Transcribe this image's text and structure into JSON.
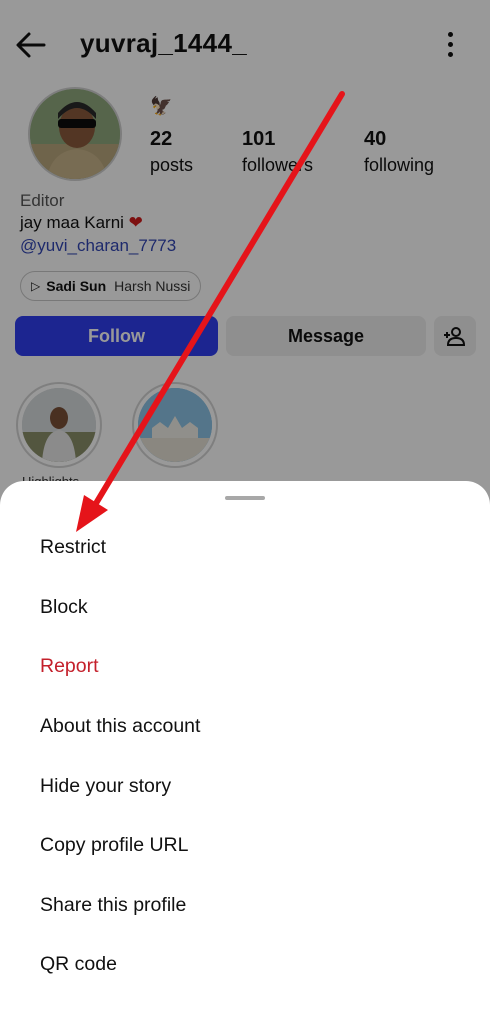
{
  "header": {
    "username": "yuvraj_1444_",
    "back_icon": "arrow-left-icon",
    "options_icon": "more-vertical-icon"
  },
  "profile": {
    "stats": [
      {
        "value": "22",
        "label": "posts"
      },
      {
        "value": "101",
        "label": "followers"
      },
      {
        "value": "40",
        "label": "following"
      }
    ],
    "bio": {
      "category": "Editor",
      "line": "jay maa Karni",
      "heart": "❤",
      "mention": "@yuvi_charan_7773"
    },
    "music": {
      "song": "Sadi Sun",
      "artist": "Harsh Nussi"
    },
    "buttons": {
      "follow": "Follow",
      "message": "Message",
      "add_user_icon": "add-user-icon"
    },
    "highlights": [
      {
        "label": "Highlights"
      }
    ]
  },
  "sheet": {
    "items": [
      {
        "label": "Restrict"
      },
      {
        "label": "Block"
      },
      {
        "label": "Report"
      },
      {
        "label": "About this account"
      },
      {
        "label": "Hide your story"
      },
      {
        "label": "Copy profile URL"
      },
      {
        "label": "Share this profile"
      },
      {
        "label": "QR code"
      }
    ]
  },
  "colors": {
    "follow_button": "#2f3ff0",
    "report_text": "#c4202b",
    "annotation_arrow": "#e5141a",
    "scrim": "rgba(0,0,0,0.40)"
  }
}
